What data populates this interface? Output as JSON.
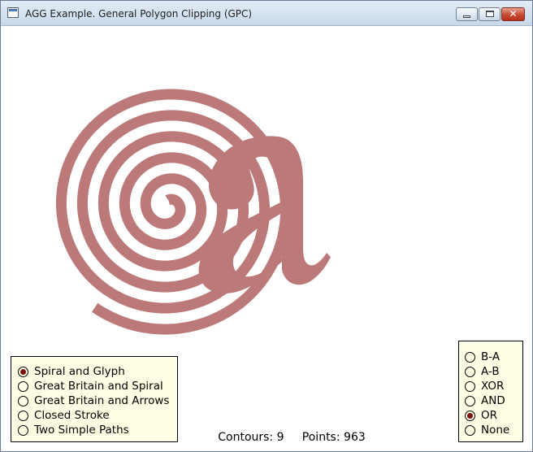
{
  "window": {
    "title": "AGG Example. General Polygon Clipping (GPC)",
    "icon": "app-window-icon",
    "controls": [
      "minimize-icon",
      "maximize-icon",
      "close-icon"
    ]
  },
  "shape_color": "#b87272",
  "mode_options": [
    {
      "label": "Spiral and Glyph",
      "selected": true
    },
    {
      "label": "Great Britain and Spiral",
      "selected": false
    },
    {
      "label": "Great Britain and Arrows",
      "selected": false
    },
    {
      "label": "Closed Stroke",
      "selected": false
    },
    {
      "label": "Two Simple Paths",
      "selected": false
    }
  ],
  "operation_options": [
    {
      "label": "B-A",
      "selected": false
    },
    {
      "label": "A-B",
      "selected": false
    },
    {
      "label": "XOR",
      "selected": false
    },
    {
      "label": "AND",
      "selected": false
    },
    {
      "label": "OR",
      "selected": true
    },
    {
      "label": "None",
      "selected": false
    }
  ],
  "status": {
    "contours_label": "Contours:",
    "contours_value": "9",
    "points_label": "Points:",
    "points_value": "963"
  }
}
